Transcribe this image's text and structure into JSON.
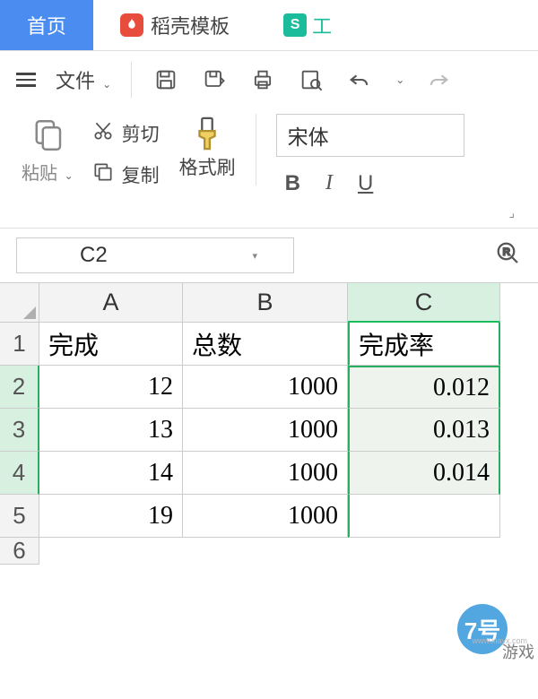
{
  "tabs": {
    "home": "首页",
    "daoke": "稻壳模板",
    "sheet": "工"
  },
  "toolbar": {
    "file": "文件",
    "paste": "粘贴",
    "cut": "剪切",
    "copy": "复制",
    "brush": "格式刷",
    "font_name": "宋体",
    "bold": "B",
    "italic": "I",
    "underline": "U"
  },
  "namebox": {
    "ref": "C2"
  },
  "grid": {
    "cols": [
      "A",
      "B",
      "C"
    ],
    "rows": [
      "1",
      "2",
      "3",
      "4",
      "5",
      "6"
    ],
    "headers": {
      "a": "完成",
      "b": "总数",
      "c": "完成率"
    },
    "data": [
      {
        "a": "12",
        "b": "1000",
        "c": "0.012"
      },
      {
        "a": "13",
        "b": "1000",
        "c": "0.013"
      },
      {
        "a": "14",
        "b": "1000",
        "c": "0.014"
      },
      {
        "a": "19",
        "b": "1000",
        "c": ""
      }
    ]
  },
  "watermark": {
    "num": "7号",
    "label": "游戏",
    "domain": "www.xiayx.com"
  }
}
